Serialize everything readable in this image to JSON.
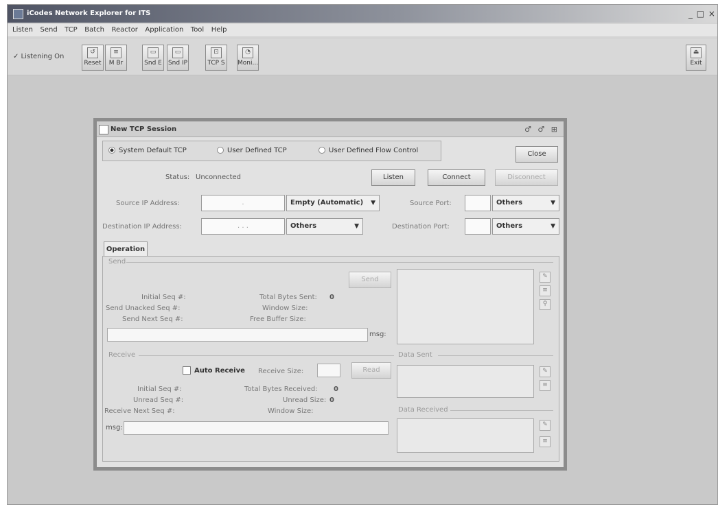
{
  "app": {
    "title": "iCodes Network Explorer for ITS",
    "window_controls": "_ □ ×"
  },
  "menu": [
    "Listen",
    "Send",
    "TCP",
    "Batch",
    "Reactor",
    "Application",
    "Tool",
    "Help"
  ],
  "toolbar": {
    "listening": "✓ Listening On",
    "buttons": [
      {
        "label": "Reset",
        "icon": "reset-icon"
      },
      {
        "label": "M Br",
        "icon": "broadcast-icon"
      },
      {
        "label": "Snd E",
        "icon": "send-ethernet-icon"
      },
      {
        "label": "Snd IP",
        "icon": "send-ip-icon"
      },
      {
        "label": "TCP S",
        "icon": "tcp-session-icon"
      },
      {
        "label": "Moni...",
        "icon": "monitor-icon"
      }
    ],
    "exit_label": "Exit"
  },
  "dialog": {
    "title": "New TCP Session",
    "title_controls": "♂ ♂ ⊞",
    "radios": [
      {
        "label": "System Default TCP",
        "selected": true
      },
      {
        "label": "User Defined TCP",
        "selected": false
      },
      {
        "label": "User Defined Flow Control",
        "selected": false
      }
    ],
    "close_label": "Close",
    "status_label": "Status:",
    "status_value": "Unconnected",
    "listen_label": "Listen",
    "connect_label": "Connect",
    "disconnect_label": "Disconnect",
    "source_ip_label": "Source IP Address:",
    "source_ip_value": ".",
    "source_ip_combo": "Empty (Automatic)",
    "source_port_label": "Source Port:",
    "source_port_combo": "Others",
    "dest_ip_label": "Destination IP Address:",
    "dest_ip_value": ". . .",
    "dest_ip_combo": "Others",
    "dest_port_label": "Destination Port:",
    "dest_port_combo": "Others",
    "tab_operation": "Operation",
    "send": {
      "title": "Send",
      "send_button": "Send",
      "initial_seq": "Initial Seq #:",
      "send_unacked": "Send Unacked Seq #:",
      "send_next": "Send Next Seq #:",
      "total_bytes_sent": "Total Bytes Sent:",
      "total_bytes_sent_value": "0",
      "window_size": "Window Size:",
      "free_buffer": "Free Buffer Size:",
      "msg_label": "msg:"
    },
    "receive": {
      "title": "Receive",
      "auto_receive": "Auto Receive",
      "receive_size": "Receive Size:",
      "read_button": "Read",
      "initial_seq": "Initial Seq #:",
      "unread_seq": "Unread Seq #:",
      "receive_next": "Receive Next Seq #:",
      "total_bytes_received": "Total Bytes Received:",
      "total_bytes_received_value": "0",
      "unread_size": "Unread Size:",
      "unread_size_value": "0",
      "window_size": "Window Size:",
      "msg_label": "msg:"
    },
    "data_sent": "Data Sent",
    "data_received": "Data Received"
  }
}
